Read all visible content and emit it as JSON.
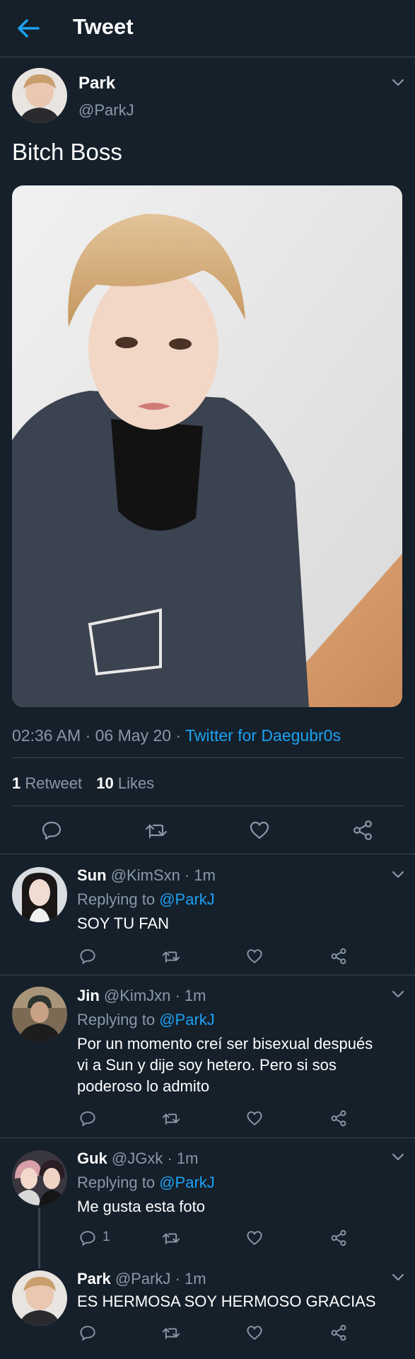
{
  "header": {
    "title": "Tweet",
    "back_icon": "arrow-left-icon",
    "accent": "#1da1f2"
  },
  "tweet": {
    "name": "Park",
    "handle": "@ParkJ",
    "text": "Bitch Boss",
    "time": "02:36 AM",
    "dot1": "·",
    "date": "06 May 20",
    "dot2": "·",
    "source": "Twitter for Daegubr0s",
    "retweet_count": "1",
    "retweet_label": "Retweet",
    "like_count": "10",
    "like_label": "Likes",
    "photo_icon": "photo-selfie-image"
  },
  "replies": [
    {
      "name": "Sun",
      "handle_time": "@KimSxn · 1m",
      "replying_label": "Replying to",
      "replying_to": "@ParkJ",
      "lines": [
        "SOY TU FAN"
      ],
      "reply_count": ""
    },
    {
      "name": "Jin",
      "handle_time": "@KimJxn · 1m",
      "replying_label": "Replying to",
      "replying_to": "@ParkJ",
      "lines": [
        "Por un momento creí ser bisexual después",
        "vi a Sun y dije soy hetero. Pero si sos",
        "poderoso lo admito"
      ],
      "reply_count": ""
    },
    {
      "name": "Guk",
      "handle_time": "@JGxk · 1m",
      "replying_label": "Replying to",
      "replying_to": "@ParkJ",
      "lines": [
        "Me gusta esta foto"
      ],
      "reply_count": "1"
    },
    {
      "name": "Park",
      "handle_time": "@ParkJ · 1m",
      "lines": [
        "ES HERMOSA SOY HERMOSO GRACIAS"
      ],
      "reply_count": ""
    }
  ],
  "icons": [
    "reply-icon",
    "retweet-icon",
    "like-icon",
    "share-icon",
    "chevron-down-icon"
  ],
  "colors": {
    "background": "#15202b",
    "border": "#38444d",
    "muted": "#8899a6",
    "text": "#ffffff"
  }
}
